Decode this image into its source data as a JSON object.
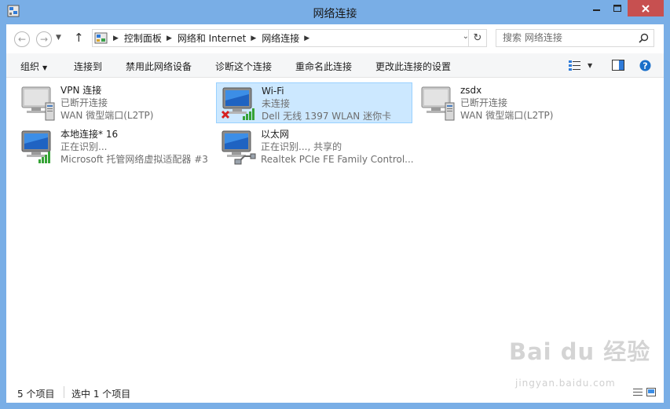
{
  "window": {
    "title": "网络连接",
    "minimize_icon": "minimize-icon",
    "maximize_icon": "maximize-icon",
    "close_icon": "close-icon",
    "close_color": "#c75050",
    "frame_color": "#79aee6"
  },
  "address": {
    "breadcrumbs": [
      "控制面板",
      "网络和 Internet",
      "网络连接"
    ],
    "search_placeholder": "搜索 网络连接"
  },
  "commands": {
    "organize": "组织",
    "connect_to": "连接到",
    "disable": "禁用此网络设备",
    "diagnose": "诊断这个连接",
    "rename": "重命名此连接",
    "change_settings": "更改此连接的设置"
  },
  "connections": [
    {
      "name": "VPN 连接",
      "status": "已断开连接",
      "device": "WAN 微型端口(L2TP)",
      "icon": "vpn-connection-icon",
      "selected": false
    },
    {
      "name": "Wi-Fi",
      "status": "未连接",
      "device": "Dell 无线 1397 WLAN 迷你卡",
      "icon": "wifi-connection-icon",
      "selected": true
    },
    {
      "name": "zsdx",
      "status": "已断开连接",
      "device": "WAN 微型端口(L2TP)",
      "icon": "vpn-connection-icon",
      "selected": false
    },
    {
      "name": "本地连接* 16",
      "status": "正在识别...",
      "device": "Microsoft 托管网络虚拟适配器 #3",
      "icon": "hosted-network-icon",
      "selected": false
    },
    {
      "name": "以太网",
      "status": "正在识别..., 共享的",
      "device": "Realtek PCIe FE Family Control...",
      "icon": "ethernet-connection-icon",
      "selected": false
    }
  ],
  "status": {
    "item_count": "5 个项目",
    "selected_count": "选中 1 个项目"
  },
  "watermark": {
    "logo": "Bai du 经验",
    "url": "jingyan.baidu.com"
  },
  "colors": {
    "selection_bg": "#cce8ff",
    "selection_border": "#99d1ff",
    "help_blue": "#1a6fc9"
  }
}
